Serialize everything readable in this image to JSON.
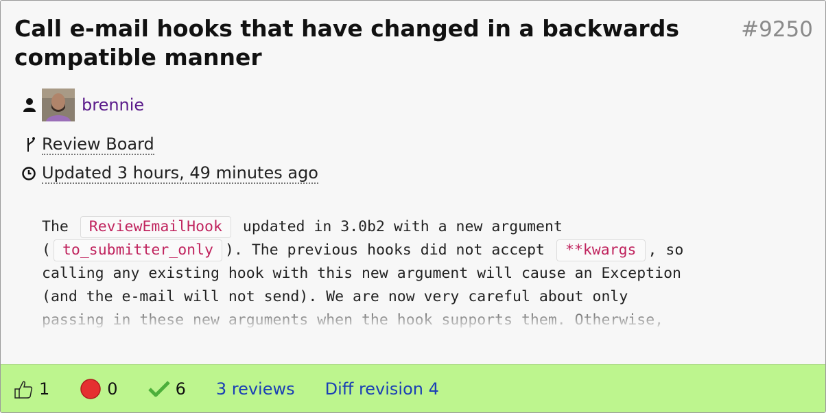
{
  "review": {
    "title": "Call e-mail hooks that have changed in a backwards compatible manner",
    "id": "#9250",
    "user": "brennie",
    "repository": "Review Board",
    "updated": "Updated 3 hours, 49 minutes ago"
  },
  "description": {
    "lines": [
      [
        {
          "t": "The "
        },
        {
          "code": "ReviewEmailHook"
        },
        {
          "t": " updated in 3.0b2 with a new argument"
        }
      ],
      [
        {
          "t": "("
        },
        {
          "code": "to_submitter_only"
        },
        {
          "t": "). The previous hooks did not accept "
        },
        {
          "code": "**kwargs"
        },
        {
          "t": ", so"
        }
      ],
      [
        {
          "t": "calling any existing hook with this new argument will cause an Exception"
        }
      ],
      [
        {
          "t": "(and the e-mail will not send). We are now very careful about only"
        }
      ],
      [
        {
          "t": "passing in these new arguments when the hook supports them. Otherwise,"
        }
      ]
    ]
  },
  "footer": {
    "ship_it_count": "1",
    "issues_count": "0",
    "resolved_count": "6",
    "reviews_label": "3 reviews",
    "diff_label": "Diff revision 4"
  },
  "colors": {
    "footer_bg": "#bdf58e",
    "link": "#1a3fb5",
    "username": "#5a1a8a",
    "code": "#c0245e",
    "issue_red": "#e53030",
    "check_green": "#4caf3a"
  },
  "icons": [
    "user-icon",
    "avatar",
    "branch-icon",
    "clock-icon",
    "thumbs-up-icon",
    "open-issue-icon",
    "checkmark-icon"
  ]
}
